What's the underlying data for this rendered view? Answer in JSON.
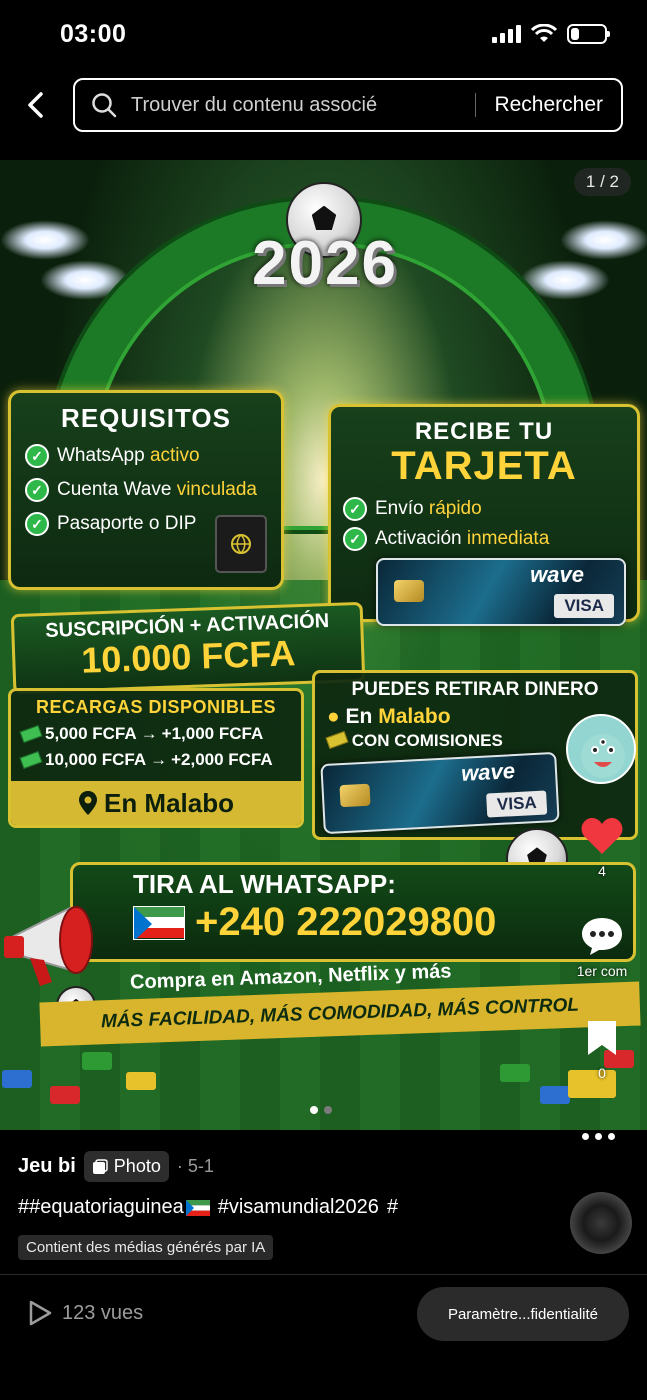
{
  "status_bar": {
    "time": "03:00",
    "battery_level": 0.25
  },
  "nav": {
    "search_placeholder": "Trouver du contenu associé",
    "search_button": "Rechercher"
  },
  "media": {
    "page_counter": "1 / 2",
    "year": "2026",
    "requisitos": {
      "title": "REQUISITOS",
      "items": [
        {
          "pre": "WhatsApp ",
          "hl": "activo",
          "post": ""
        },
        {
          "pre": "Cuenta Wave ",
          "hl": "vinculada",
          "post": ""
        },
        {
          "pre": "Pasaporte o DIP",
          "hl": "",
          "post": ""
        }
      ]
    },
    "recibe": {
      "title": "RECIBE TU",
      "big": "TARJETA",
      "items": [
        {
          "pre": "Envío ",
          "hl": "rápido"
        },
        {
          "pre": "Activación ",
          "hl": "inmediata"
        }
      ]
    },
    "card": {
      "brand": "wave",
      "network": "VISA"
    },
    "suscripcion": {
      "line1": "SUSCRIPCIÓN + ACTIVACIÓN",
      "line2": "10.000 FCFA"
    },
    "recargas": {
      "title": "RECARGAS DISPONIBLES",
      "rows": [
        {
          "from": "5,000 FCFA",
          "arrow": "→",
          "to": "+1,000 FCFA"
        },
        {
          "from": "10,000 FCFA",
          "arrow": "→",
          "to": "+2,000 FCFA"
        }
      ],
      "location": "En Malabo"
    },
    "retirar": {
      "title": "PUEDES RETIRAR DINERO",
      "pre": "En ",
      "place": "Malabo",
      "comisiones": "CON COMISIONES"
    },
    "whatsapp": {
      "title": "TIRA AL WHATSAPP:",
      "phone": "+240 222029800",
      "compra": "Compra en Amazon, Netflix y más",
      "banner": "MÁS FACILIDAD, MÁS COMODIDAD,  MÁS CONTROL"
    },
    "carousel": {
      "total": 2,
      "active": 1
    }
  },
  "rail": {
    "likes": "4",
    "comments": "1er com",
    "saves": "0",
    "colors": {
      "like": "#f0373f"
    }
  },
  "caption": {
    "author": "Jeu bi",
    "type": "Photo",
    "meta": "· 5-1",
    "hashtags": [
      "##equatoriaguinea",
      "#visamundial2026",
      "#"
    ],
    "ai_label": "Contient des médias générés par IA"
  },
  "footer": {
    "views": "123 vues",
    "privacy": "Paramètre...fidentialité"
  },
  "icons": {
    "back": "chevron-left-icon",
    "search": "search-icon",
    "check": "check-icon",
    "heart": "heart-icon",
    "comment": "comment-icon",
    "bookmark": "bookmark-icon",
    "play": "play-icon",
    "more": "more-icon"
  }
}
